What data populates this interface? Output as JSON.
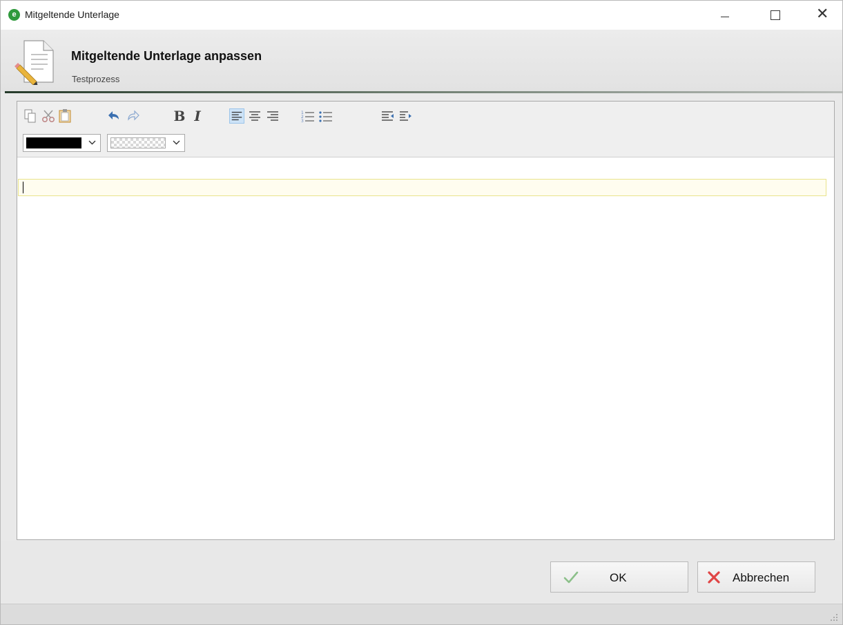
{
  "window": {
    "title": "Mitgeltende Unterlage",
    "app_icon_letter": "e",
    "controls": [
      "minimize-icon",
      "maximize-icon",
      "close-icon"
    ],
    "close_glyph": "✕"
  },
  "header": {
    "title": "Mitgeltende Unterlage anpassen",
    "subtitle": "Testprozess",
    "icon": "document-edit-icon"
  },
  "toolbar": {
    "buttons": [
      "copy-icon",
      "cut-icon",
      "paste-icon",
      "undo-icon",
      "redo-icon",
      "bold-icon",
      "italic-icon",
      "align-left-icon",
      "align-center-icon",
      "align-right-icon",
      "numbered-list-icon",
      "bullet-list-icon",
      "outdent-icon",
      "indent-icon"
    ],
    "bold_glyph": "B",
    "italic_glyph": "I",
    "active": "align-left-icon",
    "font_color": "#000000",
    "background_color": "transparent"
  },
  "editor": {
    "text": ""
  },
  "footer": {
    "ok_label": "OK",
    "cancel_label": "Abbrechen"
  },
  "colors": {
    "accent_green": "#2f9a3c",
    "cancel_red": "#e04545",
    "selection_blue": "#cde3f7"
  }
}
